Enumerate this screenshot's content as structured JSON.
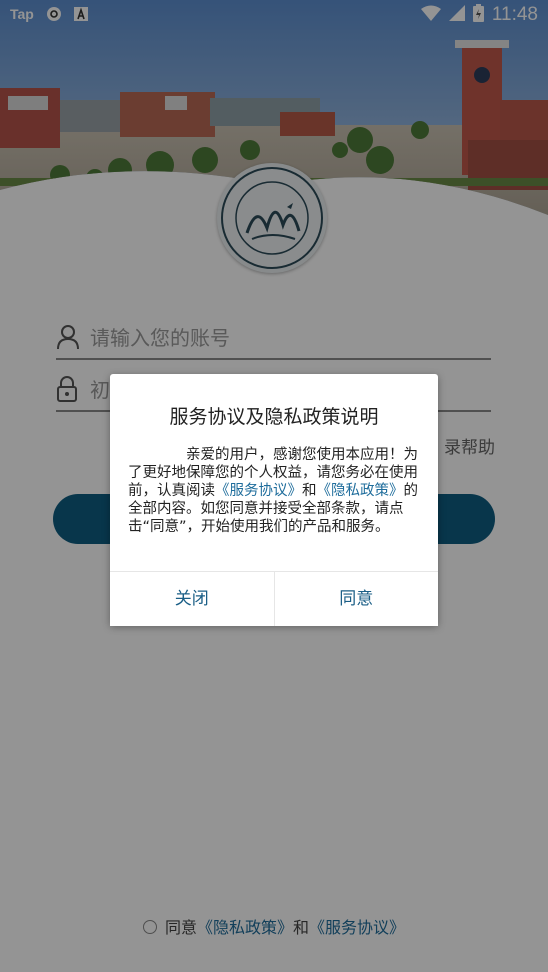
{
  "status_bar": {
    "app_label": "Tap",
    "time": "11:48",
    "icons": [
      "tap-icon",
      "sync-icon",
      "font-a-icon",
      "wifi-icon",
      "signal-icon",
      "battery-icon"
    ]
  },
  "login": {
    "account_placeholder": "请输入您的账号",
    "password_placeholder_visible": "初",
    "help_link": "录帮助"
  },
  "agreement": {
    "prefix": "同意",
    "privacy_link": "《隐私政策》",
    "and": "和",
    "service_link": "《服务协议》"
  },
  "dialog": {
    "title": "服务协议及隐私政策说明",
    "body_1": "亲爱的用户，感谢您使用本应用！为了更好地保障您的个人权益，请您务必在使用前，认真阅读",
    "service_link": "《服务协议》",
    "and": "和",
    "privacy_link": "《隐私政策》",
    "body_2": "的全部内容。如您同意并接受全部条款，请点击“同意”，开始使用我们的产品和服务。",
    "close_button": "关闭",
    "agree_button": "同意"
  },
  "colors": {
    "primary": "#0f5e82",
    "link": "#1f6d9c",
    "overlay": "rgba(0,0,0,0.42)"
  }
}
